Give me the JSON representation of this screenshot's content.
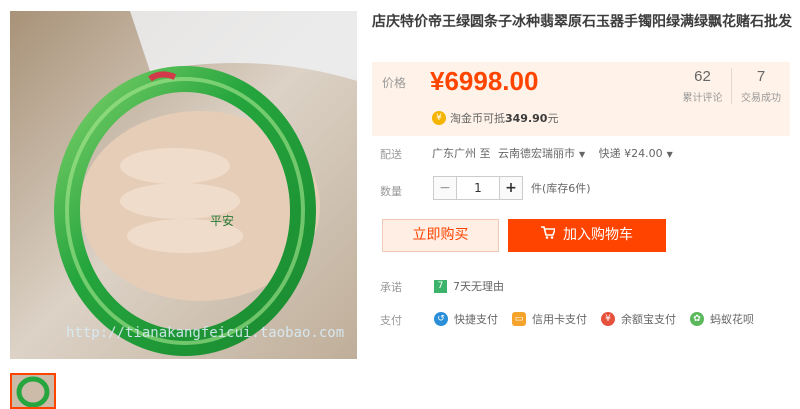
{
  "product": {
    "title": "店庆特价帝王绿圆条子冰种翡翠原石玉器手镯阳绿满绿飘花赌石批发",
    "watermark_url": "http://tianakangfeicui.taobao.com",
    "watermark_chars": "平安"
  },
  "price": {
    "label": "价格",
    "value": "¥6998.00",
    "reviews_count": "62",
    "reviews_label": "累计评论",
    "sales_count": "7",
    "sales_label": "交易成功",
    "tjb_prefix": "淘金币可抵",
    "tjb_amount": "349.90",
    "tjb_suffix": "元"
  },
  "shipping": {
    "label": "配送",
    "from": "广东广州 至",
    "to": "云南德宏瑞丽市",
    "method": "快递 ¥24.00"
  },
  "quantity": {
    "label": "数量",
    "minus": "−",
    "value": "1",
    "plus": "+",
    "stock": "件(库存6件)"
  },
  "actions": {
    "buy_now": "立即购买",
    "add_to_cart": "加入购物车"
  },
  "promise": {
    "label": "承诺",
    "badge": "7",
    "text": "7天无理由"
  },
  "payment": {
    "label": "支付",
    "methods": [
      {
        "name": "快捷支付",
        "icon": "quick-pay-icon",
        "color": "#2a8fd8"
      },
      {
        "name": "信用卡支付",
        "icon": "credit-card-icon",
        "color": "#f5a32a"
      },
      {
        "name": "余额宝支付",
        "icon": "yuebao-icon",
        "color": "#e5513d"
      },
      {
        "name": "蚂蚁花呗",
        "icon": "huabei-icon",
        "color": "#5bb85d"
      }
    ]
  },
  "colors": {
    "accent": "#ff4400",
    "price_bg": "#fff2e8",
    "jade": "#2fae4a"
  }
}
